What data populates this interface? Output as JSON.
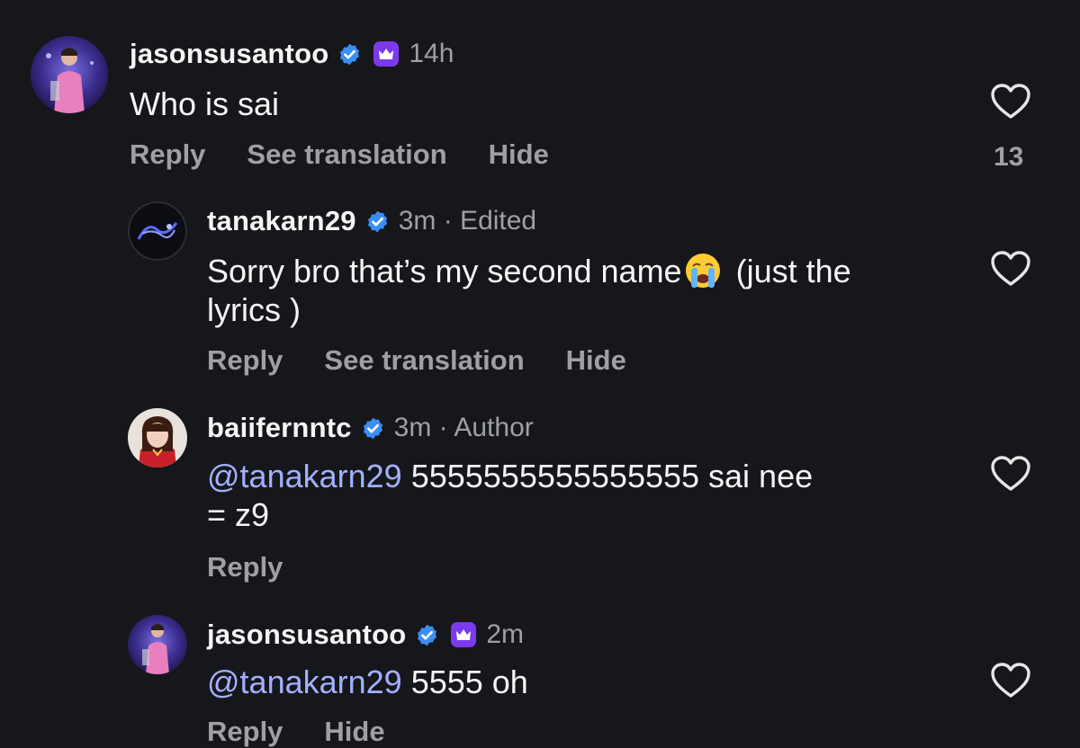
{
  "comments": [
    {
      "username": "jasonsusantoo",
      "verified": true,
      "crown": true,
      "time": "14h",
      "text": "Who is sai",
      "actions": [
        "Reply",
        "See translation",
        "Hide"
      ],
      "likes": "13"
    },
    {
      "username": "tanakarn29",
      "verified": true,
      "time": "3m · Edited",
      "text_line1": "Sorry bro that’s my second name",
      "emoji": "crying-face",
      "text_line1_after": " (just the",
      "text_line2": "lyrics )",
      "actions": [
        "Reply",
        "See translation",
        "Hide"
      ]
    },
    {
      "username": "baiifernntc",
      "verified": true,
      "time": "3m · Author",
      "mention": "@tanakarn29",
      "text_line1": " 5555555555555555 sai nee",
      "text_line2": "= z9",
      "actions": [
        "Reply"
      ]
    },
    {
      "username": "jasonsusantoo",
      "verified": true,
      "crown": true,
      "time": "2m",
      "mention": "@tanakarn29",
      "text": " 5555 oh",
      "actions": [
        "Reply",
        "Hide"
      ]
    }
  ],
  "colors": {
    "background": "#16171b",
    "secondary_text": "#9ea0a6",
    "mention": "#a4b0ff",
    "verified": "#3a8ef6",
    "crown_badge": "#7c3aed"
  }
}
